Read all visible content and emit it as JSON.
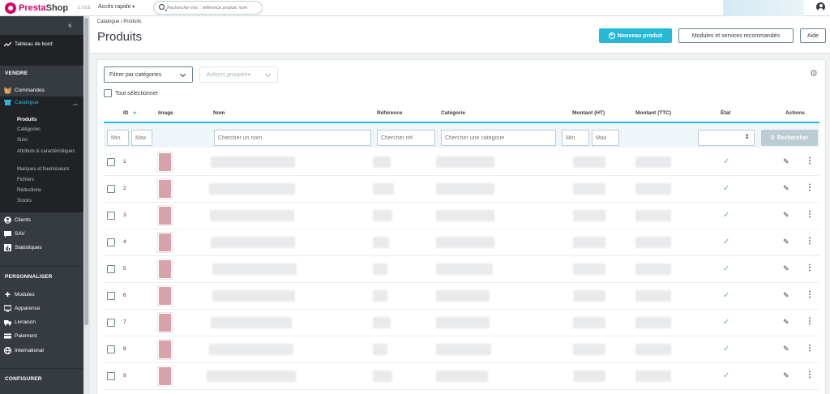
{
  "header": {
    "logo_presta": "Presta",
    "logo_shop": "Shop",
    "version": "1.7.6.5",
    "quick_access": "Accès rapide",
    "search_placeholder": "Rechercher (ex. : référence produit, nom"
  },
  "sidebar": {
    "dashboard": "Tableau de bord",
    "section_sell": "VENDRE",
    "orders": "Commandes",
    "catalog": "Catalogue",
    "catalog_sub": [
      "Produits",
      "Catégories",
      "Suivi",
      "Attributs & caractéristiques",
      "Marques et fournisseurs",
      "Fichiers",
      "Réductions",
      "Stocks"
    ],
    "customers": "Clients",
    "sav": "SAV",
    "stats": "Statistiques",
    "section_custom": "PERSONNALISER",
    "modules": "Modules",
    "appearance": "Apparence",
    "shipping": "Livraison",
    "payment": "Paiement",
    "international": "International",
    "section_config": "CONFIGURER"
  },
  "page": {
    "breadcrumb": "Catalogue  /  Produits",
    "title": "Produits",
    "btn_new": "Nouveau produit",
    "btn_modules": "Modules et services recommandés",
    "btn_help": "Aide"
  },
  "toolbar": {
    "filter_categories": "Filtrer par catégories",
    "bulk_actions": "Actions groupées",
    "select_all": "Tout sélectionner"
  },
  "table": {
    "headers": {
      "id": "ID",
      "image": "Image",
      "name": "Nom",
      "reference": "Référence",
      "category": "Catégorie",
      "price_ht": "Montant (HT)",
      "price_ttc": "Montant (TTC)",
      "status": "État",
      "actions": "Actions"
    },
    "filters": {
      "min": "Min.",
      "max": "Max",
      "name": "Chercher un nom",
      "reference": "Chercher réf.",
      "category": "Chercher une catégorie",
      "search_button": "Rechercher"
    },
    "rows": [
      {
        "id": "1"
      },
      {
        "id": "2"
      },
      {
        "id": "3"
      },
      {
        "id": "4"
      },
      {
        "id": "5"
      },
      {
        "id": "6"
      },
      {
        "id": "7"
      },
      {
        "id": "8"
      },
      {
        "id": "9"
      }
    ]
  },
  "colors": {
    "accent": "#25b9d7",
    "sidebar_bg": "#363a41",
    "brand": "#df0067",
    "success": "#70b580"
  }
}
